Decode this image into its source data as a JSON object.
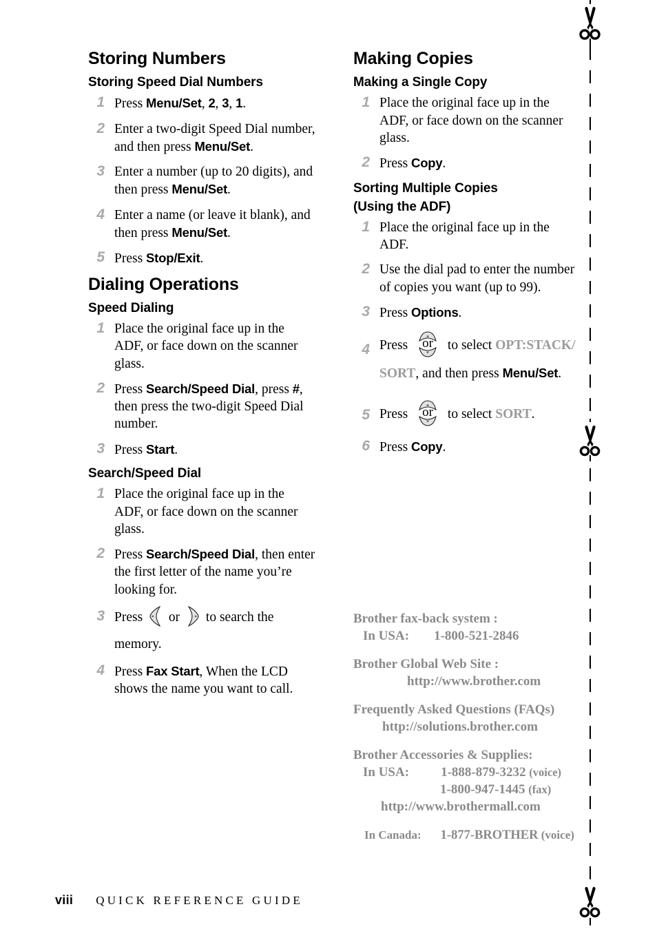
{
  "page": {
    "footer_page_number": "viii",
    "footer_text": "QUICK REFERENCE GUIDE"
  },
  "left_column": {
    "sections": [
      {
        "title": "Storing Numbers",
        "subsections": [
          {
            "heading": "Storing Speed Dial Numbers",
            "steps": [
              {
                "num": "1",
                "text_parts": [
                  "Press ",
                  "Menu/Set",
                  ", ",
                  "2",
                  ", ",
                  "3",
                  ", ",
                  "1",
                  "."
                ]
              },
              {
                "num": "2",
                "text_parts": [
                  "Enter a two-digit Speed Dial number, and then press ",
                  "Menu/Set",
                  "."
                ]
              },
              {
                "num": "3",
                "text_parts": [
                  "Enter a number (up to 20 digits), and then press ",
                  "Menu/Set",
                  "."
                ]
              },
              {
                "num": "4",
                "text_parts": [
                  "Enter a name (or leave it blank), and then press ",
                  "Menu/Set",
                  "."
                ]
              },
              {
                "num": "5",
                "text_parts": [
                  "Press ",
                  "Stop/Exit",
                  "."
                ]
              }
            ]
          }
        ]
      },
      {
        "title": "Dialing Operations",
        "subsections": [
          {
            "heading": "Speed Dialing",
            "steps": [
              {
                "num": "1",
                "text_parts": [
                  "Place the original face up in the ADF, or face down on the scanner glass."
                ]
              },
              {
                "num": "2",
                "text_parts": [
                  "Press ",
                  "Search/Speed Dial",
                  ", press ",
                  "#",
                  ", then press the two-digit Speed Dial number."
                ]
              },
              {
                "num": "3",
                "text_parts": [
                  "Press ",
                  "Start",
                  "."
                ]
              }
            ]
          },
          {
            "heading": "Search/Speed Dial",
            "steps": [
              {
                "num": "1",
                "text_parts": [
                  "Place the original face up in the ADF, or face down on the scanner glass."
                ]
              },
              {
                "num": "2",
                "text_parts": [
                  "Press ",
                  "Search/Speed Dial",
                  ", then enter the first letter of the name you’re looking for."
                ]
              },
              {
                "num": "3",
                "text_parts": [
                  "Press ",
                  "[left-arrow-key]",
                  " or ",
                  "[right-arrow-key]",
                  " to search the memory."
                ]
              },
              {
                "num": "4",
                "text_parts": [
                  "Press ",
                  "Fax Start",
                  ", When the LCD shows the name you want to call."
                ]
              }
            ]
          }
        ]
      }
    ]
  },
  "right_column": {
    "sections": [
      {
        "title": "Making Copies",
        "subsections": [
          {
            "heading": "Making a Single Copy",
            "steps": [
              {
                "num": "1",
                "text_parts": [
                  "Place the original face up in the ADF, or face down on the scanner glass."
                ]
              },
              {
                "num": "2",
                "text_parts": [
                  "Press ",
                  "Copy",
                  "."
                ]
              }
            ]
          },
          {
            "heading": "Sorting Multiple Copies (Using the ADF)",
            "heading_line1": "Sorting Multiple Copies",
            "heading_line2": "(Using the ADF)",
            "steps": [
              {
                "num": "1",
                "text_parts": [
                  "Place the original face up in the ADF."
                ]
              },
              {
                "num": "2",
                "text_parts": [
                  "Use the dial pad to enter the number of copies you want (up to 99)."
                ]
              },
              {
                "num": "3",
                "text_parts": [
                  "Press ",
                  "Options",
                  "."
                ]
              },
              {
                "num": "4",
                "text_parts": [
                  "Press ",
                  "[up-down-or-key]",
                  " to select ",
                  "OPT:STACK/SORT",
                  ", and then press ",
                  "Menu/Set",
                  "."
                ]
              },
              {
                "num": "5",
                "text_parts": [
                  "Press ",
                  "[up-down-or-key]",
                  " to select ",
                  "SORT",
                  "."
                ]
              },
              {
                "num": "6",
                "text_parts": [
                  "Press ",
                  "Copy",
                  "."
                ]
              }
            ]
          }
        ]
      }
    ]
  },
  "labels": {
    "press": "Press ",
    "or": "or",
    "period": ".",
    "comma": ", ",
    "step1_menuset": "Menu/Set",
    "step1_d2": "2",
    "step1_d3": "3",
    "step1_d1": "1",
    "stop_exit": "Stop/Exit",
    "start": "Start",
    "copy": "Copy",
    "options": "Options",
    "fax_start": "Fax Start",
    "search_speed_dial": "Search/Speed Dial",
    "hash": "#",
    "opt_stack_sort_1": "OPT:STACK/",
    "opt_stack_sort_2": "SORT",
    "sort": "SORT",
    "to_select": " to select ",
    "and_then_press": ", and then press ",
    "to_search_the_memory_a": " to search the ",
    "to_search_the_memory_b": "memory.",
    "enter_two_digit_a": "Enter a two-digit Speed Dial number, and then press ",
    "enter_number_a": "Enter a number (up to 20 digits), and then press ",
    "enter_name_a": "Enter a name (or leave it blank), and then press ",
    "place_original_scanner": "Place the original face up in the ADF, or face down on the scanner glass.",
    "place_original_adf": "Place the original face up in the ADF.",
    "press_ssd_comma_press": ", press ",
    "then_press_two_digit": ", then press the two-digit Speed Dial number.",
    "then_enter_first_letter": ", then enter the first letter of the name you’re looking for.",
    "use_dial_pad": "Use the dial pad to enter the number of copies you want (up to 99).",
    "when_lcd_shows": ", When the LCD shows the name you want to call."
  },
  "contact": {
    "groups": [
      {
        "title": "Brother fax-back system :",
        "lines": [
          {
            "label": "In USA:",
            "value": "1-800-521-2846"
          }
        ]
      },
      {
        "title": "Brother Global Web Site :",
        "lines": [
          {
            "label": "",
            "value": "http://www.brother.com"
          }
        ]
      },
      {
        "title": "Frequently Asked Questions (FAQs)",
        "lines": [
          {
            "label": "",
            "value": "http://solutions.brother.com"
          }
        ]
      },
      {
        "title": "Brother Accessories & Supplies:",
        "lines": [
          {
            "label": "In USA:",
            "value": "1-888-879-3232",
            "suffix": "(voice)"
          },
          {
            "label": "",
            "value": "1-800-947-1445",
            "suffix": "(fax)"
          },
          {
            "label": "",
            "value": "http://www.brothermall.com"
          }
        ]
      },
      {
        "title": "",
        "lines": [
          {
            "label": "In Canada:",
            "value": "1-877-BROTHER",
            "suffix": "(voice)"
          }
        ]
      }
    ],
    "faxback_title": "Brother fax-back system :",
    "faxback_usa_label": "In USA:",
    "faxback_usa_number": "1-800-521-2846",
    "global_title": "Brother Global Web Site :",
    "global_url": "http://www.brother.com",
    "faq_title": "Frequently Asked Questions (FAQs)",
    "faq_url": "http://solutions.brother.com",
    "acc_title": "Brother Accessories & Supplies:",
    "acc_usa_label": "In USA:",
    "acc_voice_number": "1-888-879-3232",
    "acc_voice_suffix": "(voice)",
    "acc_fax_number": "1-800-947-1445",
    "acc_fax_suffix": "(fax)",
    "acc_url": "http://www.brothermall.com",
    "canada_label": "In Canada:",
    "canada_number": "1-877-BROTHER",
    "canada_suffix": "(voice)"
  },
  "colors": {
    "step_number_gray": "#a9a9a9",
    "lcd_gray": "#9b9b9b",
    "contact_gray": "#8a8a8a",
    "key_fill": "#e0e0e0",
    "text_black": "#000000"
  },
  "icons": {
    "scissors": "scissors-icon",
    "cut_line": "dashed-cut-line",
    "left_arrow_key": "left-arrow-key-icon",
    "right_arrow_key": "right-arrow-key-icon",
    "up_down_or_key": "up-down-arrow-key-icon"
  }
}
